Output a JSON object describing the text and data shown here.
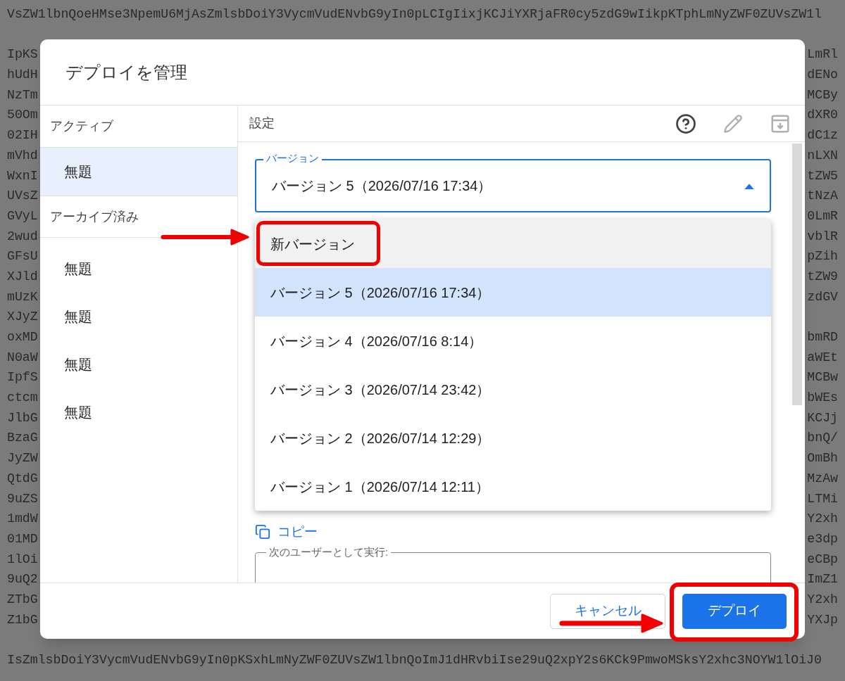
{
  "background_code": {
    "top_line": "VsZW1lbnQoeHMse3NpemU6MjAsZmlsbDoiY3VycmVudENvbG9yIn0pLCIgIixjKCJiYXRjaFR0cy5zdG9wIikpKTphLmNyZWF0ZUVsZW1l",
    "rows": [
      {
        "left": "IpKS",
        "right": "LmRl"
      },
      {
        "left": "hUdH",
        "right": "dENo"
      },
      {
        "left": "NzTm",
        "right": "MCBy"
      },
      {
        "left": "50Om",
        "right": "dXR0"
      },
      {
        "left": "02IH",
        "right": "dC1z"
      },
      {
        "left": "mVhd",
        "right": "nLXN"
      },
      {
        "left": "WxnI",
        "right": "tZW5"
      },
      {
        "left": "UVsZ",
        "right": "tNzA"
      },
      {
        "left": "GVyL",
        "right": "0LmR"
      },
      {
        "left": "2wud",
        "right": "vblR"
      },
      {
        "left": "GFsU",
        "right": "pZih"
      },
      {
        "left": "XJld",
        "right": "tZW9"
      },
      {
        "left": "mUzK",
        "right": "zdGV"
      },
      {
        "left": "XJyZ"
      },
      {
        "left": "oxMD",
        "right": "bmRD"
      },
      {
        "left": "N0aW",
        "right": "aWEt"
      },
      {
        "left": "IpfS",
        "right": "MCBw"
      },
      {
        "left": "ctcm",
        "right": "bWEs"
      },
      {
        "left": "JlbG",
        "right": "KCJj"
      },
      {
        "left": "BzaG",
        "right": "bnQ/"
      },
      {
        "left": "JyZW",
        "right": "OmBh"
      },
      {
        "left": "QtdG",
        "right": "MzAw"
      },
      {
        "left": "9uZS",
        "right": "LTMi"
      },
      {
        "left": "1mdW",
        "right": "Y2xh"
      },
      {
        "left": "01MD",
        "right": "e3dp"
      },
      {
        "left": "1lOi",
        "right": "eCBp"
      },
      {
        "left": "9uQ2",
        "right": "ImZ1"
      },
      {
        "left": "ZTbG",
        "right": "Y2xh"
      },
      {
        "left": "Z1bG",
        "right": "YXJp"
      }
    ],
    "bottom_line": "IsZmlsbDoiY3VycmVudENvbG9yIn0pKSxhLmNyZWF0ZUVsZW1lbnQoImJ1dHRvbiIse29uQ2xpY2s6KCk9PmwoMSksY2xhc3NOYW1lOiJ0"
  },
  "dialog": {
    "title": "デプロイを管理",
    "sidebar": [
      {
        "heading": "アクティブ",
        "items": [
          {
            "label": "無題",
            "selected": true
          }
        ]
      },
      {
        "heading": "アーカイブ済み",
        "items": [
          {
            "label": "無題",
            "selected": false
          },
          {
            "label": "無題",
            "selected": false
          },
          {
            "label": "無題",
            "selected": false
          },
          {
            "label": "無題",
            "selected": false
          }
        ]
      }
    ],
    "panel": {
      "heading": "設定",
      "tools": [
        {
          "kind": "help",
          "disabled": false
        },
        {
          "kind": "edit",
          "disabled": true
        },
        {
          "kind": "archive",
          "disabled": true
        }
      ],
      "version_field": {
        "label": "バージョン",
        "value": "バージョン 5（2026/07/16 17:34）",
        "expanded": true
      },
      "version_menu": [
        {
          "label": "新バージョン",
          "selected": false,
          "hovered": true,
          "annotated": true
        },
        {
          "label": "バージョン 5（2026/07/16 17:34）",
          "selected": true,
          "hovered": false,
          "annotated": false
        },
        {
          "label": "バージョン 4（2026/07/16 8:14）",
          "selected": false,
          "hovered": false,
          "annotated": false
        },
        {
          "label": "バージョン 3（2026/07/14 23:42）",
          "selected": false,
          "hovered": false,
          "annotated": false
        },
        {
          "label": "バージョン 2（2026/07/14 12:29）",
          "selected": false,
          "hovered": false,
          "annotated": false
        },
        {
          "label": "バージョン 1（2026/07/14 12:11）",
          "selected": false,
          "hovered": false,
          "annotated": false
        }
      ],
      "copy_link": "コピー",
      "execute_as_field": {
        "label": "次のユーザーとして実行:"
      }
    },
    "buttons": [
      {
        "label": "キャンセル",
        "kind": "secondary",
        "annotated": false
      },
      {
        "label": "デプロイ",
        "kind": "primary",
        "annotated": true
      }
    ]
  }
}
